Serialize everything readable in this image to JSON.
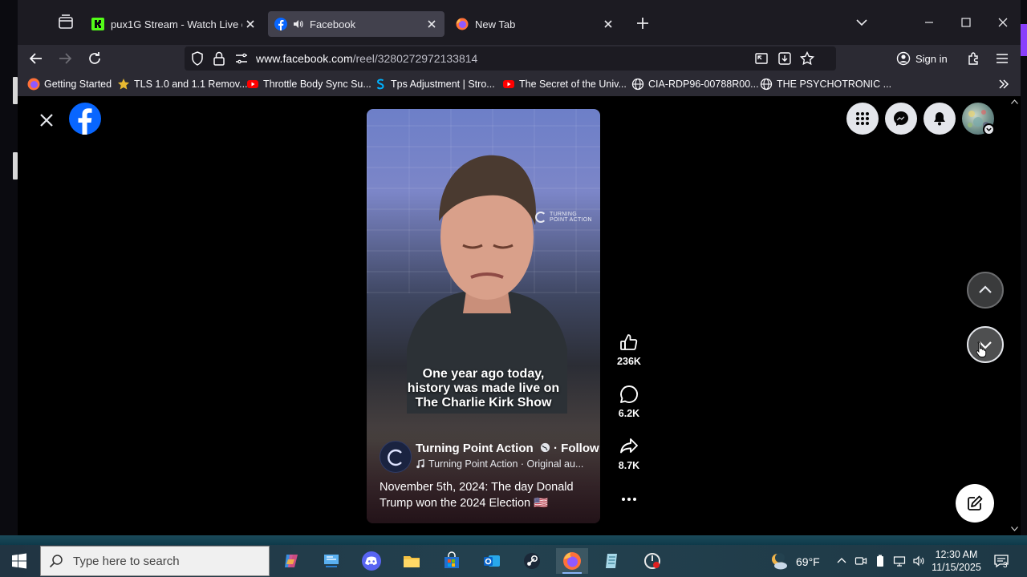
{
  "browser": {
    "tabs": [
      {
        "title": "pux1G Stream - Watch Live on K",
        "favicon": "kick-icon",
        "active": false
      },
      {
        "title": "Facebook",
        "favicon": "facebook-icon",
        "active": true,
        "playing_audio": true
      },
      {
        "title": "New Tab",
        "favicon": "firefox-icon",
        "active": false
      }
    ],
    "url": {
      "domain": "www.facebook.com",
      "path": "/reel/3280272972133814"
    },
    "signin_label": "Sign in",
    "bookmarks": [
      {
        "label": "Getting Started",
        "icon": "firefox-icon"
      },
      {
        "label": "TLS 1.0 and 1.1 Remov...",
        "icon": "star-icon"
      },
      {
        "label": "Throttle Body Sync Su...",
        "icon": "youtube-icon"
      },
      {
        "label": "Tps Adjustment | Stro...",
        "icon": "s-icon"
      },
      {
        "label": "The Secret of the Univ...",
        "icon": "youtube-icon"
      },
      {
        "label": "CIA-RDP96-00788R00...",
        "icon": "globe-icon"
      },
      {
        "label": "THE PSYCHOTRONIC ...",
        "icon": "globe-icon"
      }
    ]
  },
  "reel": {
    "watermark_line1": "TURNING",
    "watermark_line2": "POINT ACTION",
    "caption_lines": [
      "One year ago today,",
      "history was made live on",
      "The Charlie Kirk Show"
    ],
    "page_name": "Turning Point Action",
    "follow_label": "Follow",
    "audio_text": "Turning Point Action · Original au...",
    "description": "November 5th, 2024: The day Donald Trump won the 2024 Election 🇺🇸",
    "likes": "236K",
    "comments": "6.2K",
    "shares": "8.7K"
  },
  "taskbar": {
    "search_placeholder": "Type here to search",
    "weather_temp": "69°F",
    "time": "12:30 AM",
    "date": "11/15/2025",
    "notification_count": "3"
  },
  "colors": {
    "facebook_blue": "#0866ff",
    "browser_bg": "#1c1b22",
    "toolbar_bg": "#2b2a33"
  }
}
